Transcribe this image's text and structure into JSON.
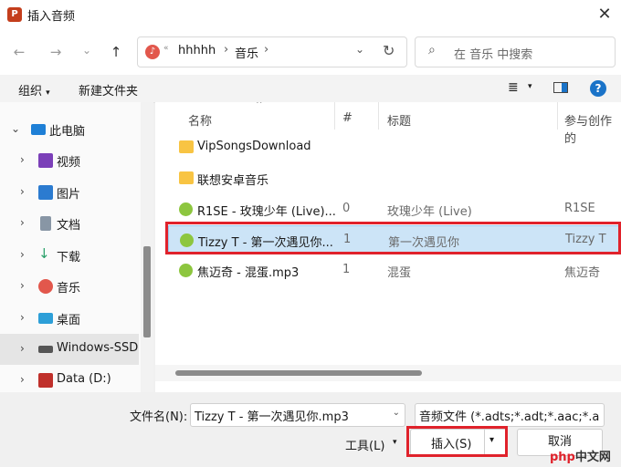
{
  "window": {
    "title": "插入音频",
    "app_icon": "P",
    "close_label": "✕"
  },
  "nav": {
    "back": "←",
    "forward": "→",
    "recent": "⌄",
    "up": "↑",
    "address": {
      "dots": "«",
      "segments": [
        "hhhhh",
        "音乐"
      ],
      "separator": "›",
      "dropdown": "⌄",
      "refresh": "↻"
    },
    "search_placeholder": "在 音乐 中搜索",
    "search_icon": "⌕"
  },
  "toolbar": {
    "organize": "组织",
    "organize_arrow": "▾",
    "new_folder": "新建文件夹",
    "view_icon": "≣",
    "view_arrow": "▾",
    "help": "?"
  },
  "sidebar": {
    "items": [
      {
        "label": "此电脑",
        "icon": "computer-icon",
        "color": "#1e7fd6",
        "expander": "⌄"
      },
      {
        "label": "视频",
        "icon": "video-icon",
        "color": "#7b3fb8",
        "expander": "›"
      },
      {
        "label": "图片",
        "icon": "picture-icon",
        "color": "#2b7bd0",
        "expander": "›"
      },
      {
        "label": "文档",
        "icon": "document-icon",
        "color": "#8896a5",
        "expander": "›"
      },
      {
        "label": "下载",
        "icon": "download-icon",
        "color": "#2aa06a",
        "expander": "›"
      },
      {
        "label": "音乐",
        "icon": "music-icon",
        "color": "#e2574c",
        "expander": "›"
      },
      {
        "label": "桌面",
        "icon": "desktop-icon",
        "color": "#2d9fd8",
        "expander": "›"
      },
      {
        "label": "Windows-SSD",
        "icon": "drive-icon",
        "color": "#555555",
        "expander": "›"
      },
      {
        "label": "Data (D:)",
        "icon": "drive-icon",
        "color": "#c0302b",
        "expander": "›"
      }
    ]
  },
  "columns": {
    "name": "名称",
    "num": "#",
    "title": "标题",
    "artist": "参与创作的"
  },
  "files": [
    {
      "name": "VipSongsDownload",
      "num": "",
      "title": "",
      "artist": "",
      "type": "folder"
    },
    {
      "name": "联想安卓音乐",
      "num": "",
      "title": "",
      "artist": "",
      "type": "folder"
    },
    {
      "name": "R1SE - 玫瑰少年 (Live)...",
      "num": "0",
      "title": "玫瑰少年 (Live)",
      "artist": "R1SE",
      "type": "music"
    },
    {
      "name": "Tizzy T - 第一次遇见你...",
      "num": "1",
      "title": "第一次遇见你",
      "artist": "Tizzy T",
      "type": "music",
      "selected": true
    },
    {
      "name": "焦迈奇 - 混蛋.mp3",
      "num": "1",
      "title": "混蛋",
      "artist": "焦迈奇",
      "type": "music"
    }
  ],
  "bottom": {
    "filename_label": "文件名(N):",
    "filename_value": "Tizzy T - 第一次遇见你.mp3",
    "filetype_value": "音频文件 (*.adts;*.adt;*.aac;*.a",
    "tools_label": "工具(L)",
    "tools_arrow": "▾",
    "insert_label": "插入(S)",
    "insert_arrow": "▾",
    "cancel_label": "取消"
  },
  "watermark": {
    "php": "php",
    "cn": "中文网"
  },
  "colors": {
    "highlight": "#e0222b",
    "selection": "#cce4f7",
    "accent": "#1a73c8"
  }
}
